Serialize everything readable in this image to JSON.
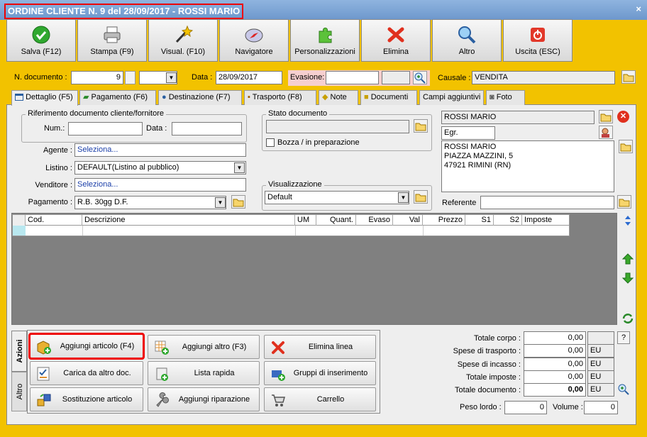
{
  "window": {
    "title": "ORDINE CLIENTE N. 9 del 28/09/2017 - ROSSI MARIO",
    "close": "×"
  },
  "toolbar": [
    {
      "label": "Salva (F12)",
      "icon": "save-check-icon"
    },
    {
      "label": "Stampa (F9)",
      "icon": "printer-icon"
    },
    {
      "label": "Visual. (F10)",
      "icon": "magic-wand-icon"
    },
    {
      "label": "Navigatore",
      "icon": "compass-icon"
    },
    {
      "label": "Personalizzazioni",
      "icon": "puzzle-icon"
    },
    {
      "label": "Elimina",
      "icon": "delete-x-icon"
    },
    {
      "label": "Altro",
      "icon": "magnifier-icon"
    },
    {
      "label": "Uscita (ESC)",
      "icon": "power-icon"
    }
  ],
  "header": {
    "ndoc_label": "N. documento :",
    "ndoc_value": "9",
    "ndoc_suffix": "",
    "data_label": "Data :",
    "data_value": "28/09/2017",
    "evasione_label": "Evasione:",
    "evasione_value": "",
    "causale_label": "Causale :",
    "causale_value": "VENDITA"
  },
  "tabs": [
    "Dettaglio (F5)",
    "Pagamento (F6)",
    "Destinazione (F7)",
    "Trasporto (F8)",
    "Note",
    "Documenti",
    "Campi aggiuntivi",
    "Foto"
  ],
  "riferimento": {
    "title": "Riferimento documento cliente/fornitore",
    "num_label": "Num.:",
    "num_value": "",
    "data_label": "Data :",
    "data_value": ""
  },
  "agente": {
    "label": "Agente :",
    "value": "Seleziona..."
  },
  "listino": {
    "label": "Listino :",
    "value": "DEFAULT(Listino al pubblico)"
  },
  "venditore": {
    "label": "Venditore :",
    "value": "Seleziona..."
  },
  "pagamento": {
    "label": "Pagamento :",
    "value": "R.B. 30gg D.F."
  },
  "stato": {
    "title": "Stato documento",
    "value": "",
    "bozza": "Bozza / in preparazione"
  },
  "visual": {
    "title": "Visualizzazione",
    "value": "Default"
  },
  "cliente": {
    "name": "ROSSI MARIO",
    "title": "Egr.",
    "address": [
      "ROSSI MARIO",
      "PIAZZA MAZZINI, 5",
      "47921 RIMINI (RN)"
    ],
    "referente_label": "Referente",
    "referente_value": ""
  },
  "grid": {
    "columns": [
      "Cod.",
      "Descrizione",
      "UM",
      "Quant.",
      "Evaso",
      "Val",
      "Prezzo",
      "S1",
      "S2",
      "Imposte"
    ]
  },
  "side_tabs": [
    "Azioni",
    "Altro"
  ],
  "actions": [
    {
      "label": "Aggiungi articolo (F4)",
      "icon": "box-add-icon"
    },
    {
      "label": "Aggiungi altro (F3)",
      "icon": "grid-add-icon"
    },
    {
      "label": "Elimina linea",
      "icon": "delete-line-icon"
    },
    {
      "label": "Carica da altro doc.",
      "icon": "checklist-icon"
    },
    {
      "label": "Lista rapida",
      "icon": "quick-list-icon"
    },
    {
      "label": "Gruppi di inserimento",
      "icon": "group-add-icon"
    },
    {
      "label": "Sostituzione articolo",
      "icon": "swap-icon"
    },
    {
      "label": "Aggiungi riparazione",
      "icon": "wrench-icon"
    },
    {
      "label": "Carrello",
      "icon": "cart-icon"
    }
  ],
  "totals": {
    "corpo_label": "Totale corpo :",
    "corpo_value": "0,00",
    "help": "?",
    "trasporto_label": "Spese di trasporto :",
    "trasporto_value": "0,00",
    "trasporto_cur": "EU",
    "incasso_label": "Spese di incasso :",
    "incasso_value": "0,00",
    "incasso_cur": "EU",
    "imposte_label": "Totale imposte :",
    "imposte_value": "0,00",
    "imposte_cur": "EU",
    "documento_label": "Totale documento :",
    "documento_value": "0,00",
    "documento_cur": "EU",
    "peso_label": "Peso lordo :",
    "peso_value": "0",
    "volume_label": "Volume :",
    "volume_value": "0"
  }
}
